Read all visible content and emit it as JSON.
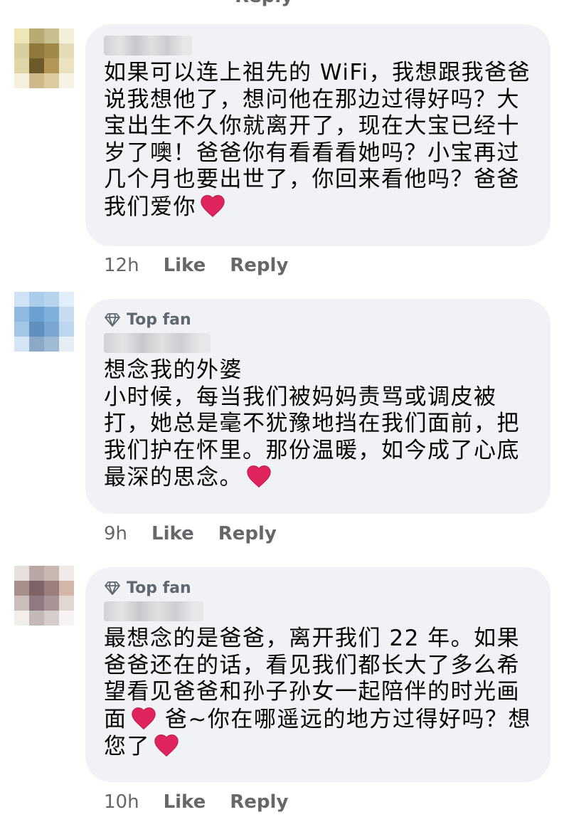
{
  "top_partial": {
    "reply_label": "Reply"
  },
  "comments": [
    {
      "top_fan": "",
      "text": "如果可以连上祖先的 WiFi，我想跟我爸爸说我想他了，想问他在那边过得好吗？大宝出生不久你就离开了，现在大宝已经十岁了噢！爸爸你有看看看她吗？小宝再过几个月也要出世了，你回来看他吗？爸爸我们爱你",
      "time": "12h",
      "like": "Like",
      "reply": "Reply"
    },
    {
      "top_fan": "Top fan",
      "text": "想念我的外婆\n小时候，每当我们被妈妈责骂或调皮被打，她总是毫不犹豫地挡在我们面前，把我们护在怀里。那份温暖，如今成了心底最深的思念。",
      "time": "9h",
      "like": "Like",
      "reply": "Reply"
    },
    {
      "top_fan": "Top fan",
      "text": "最想念的是爸爸，离开我们 22 年。如果爸爸还在的话，看见我们都长大了多么希望看见爸爸和孙子孙女一起陪伴的时光画面",
      "text_after_heart": " 爸~你在哪遥远的地方过得好吗？想您了",
      "time": "10h",
      "like": "Like",
      "reply": "Reply"
    }
  ],
  "colors": {
    "bubble": "#f0f2f5",
    "meta": "#65676b",
    "heart": "#e0245e"
  },
  "icons": {
    "top_fan": "diamond-icon",
    "reaction": "red-heart-icon"
  }
}
